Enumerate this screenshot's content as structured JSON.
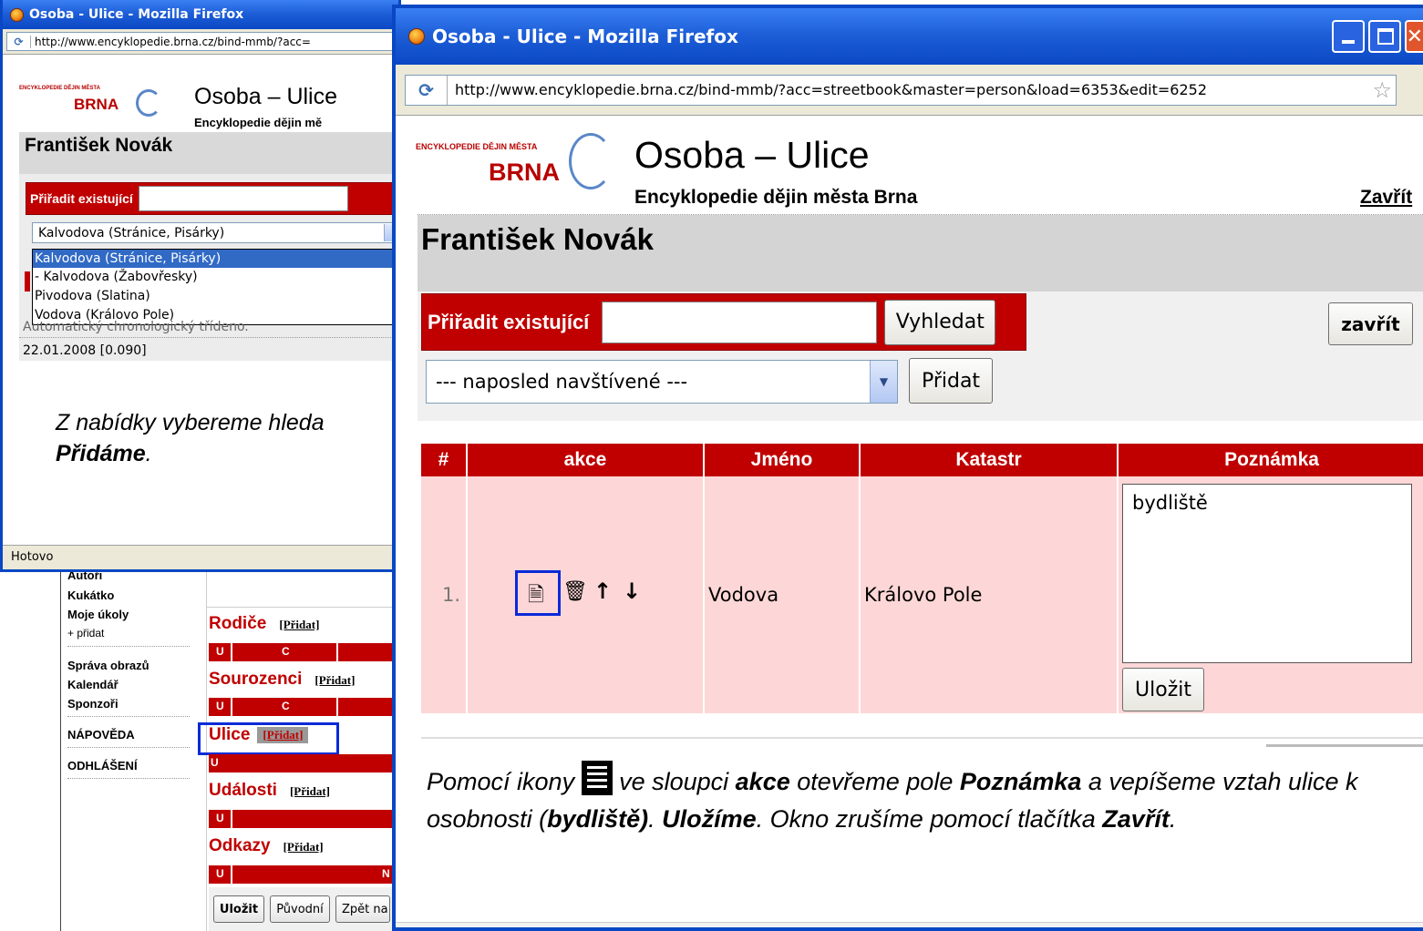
{
  "back_window": {
    "title": "Osoba - Ulice - Mozilla Firefox",
    "url": "http://www.encyklopedie.brna.cz/bind-mmb/?acc=",
    "logo_top": "ENCYKLOPEDIE DĚJIN MĚSTA",
    "logo_brna": "BRNA",
    "site_title": "Osoba – Ulice",
    "site_subtitle": "Encyklopedie dějin mě",
    "person_name": "František Novák",
    "assign_label": "Přiřadit existující",
    "select_value": "Kalvodova (Stránice, Pisárky)",
    "dropdown_options": [
      "Kalvodova (Stránice, Pisárky)",
      "- Kalvodova (Žabovřesky)",
      "Pivodova (Slatina)",
      "Vodova (Královo Pole)"
    ],
    "auto_text": "Automatický chronologický třídeno.",
    "date_text": "22.01.2008 [0.090]",
    "note_line1": "Z nabídky vybereme hleda",
    "note_line2": "Přidáme",
    "note_line2_end": ".",
    "status": "Hotovo"
  },
  "bg_page": {
    "sidebar": [
      "Autoři",
      "Kukátko",
      "Moje úkoly",
      "+ přidat",
      "Správa obrazů",
      "Kalendář",
      "Sponzoři",
      "NÁPOVĚDA",
      "ODHLÁŠENÍ"
    ],
    "sections": [
      {
        "title": "Rodiče",
        "link": "[Přidat]",
        "bar": [
          "U",
          "C"
        ]
      },
      {
        "title": "Sourozenci",
        "link": "[Přidat]",
        "bar": [
          "U",
          "C"
        ]
      },
      {
        "title": "Ulice",
        "link": "[Přidat]",
        "bar": [
          "U"
        ]
      },
      {
        "title": "Události",
        "link": "[Přidat]",
        "bar": [
          "U"
        ]
      },
      {
        "title": "Odkazy",
        "link": "[Přidat]",
        "bar": [
          "U",
          "N"
        ]
      }
    ],
    "buttons": [
      "Uložit",
      "Původní",
      "Zpět na"
    ]
  },
  "front_window": {
    "title": "Osoba - Ulice - Mozilla Firefox",
    "url": "http://www.encyklopedie.brna.cz/bind-mmb/?acc=streetbook&master=person&load=6353&edit=6252",
    "logo_top": "ENCYKLOPEDIE DĚJIN MĚSTA",
    "logo_brna": "BRNA",
    "site_title": "Osoba – Ulice",
    "site_subtitle": "Encyklopedie dějin města Brna",
    "close_link": "Zavřít",
    "person_name": "František Novák",
    "assign_label": "Přiřadit existující",
    "assign_input_value": "",
    "search_button": "Vyhledat",
    "close_button": "zavřít",
    "select_value": "--- naposled navštívené ---",
    "add_button": "Přidat",
    "table": {
      "headers": [
        "#",
        "akce",
        "Jméno",
        "Katastr",
        "Poznámka"
      ],
      "rows": [
        {
          "num": "1.",
          "name": "Vodova",
          "katastr": "Královo Pole",
          "note": "bydliště",
          "save": "Uložit"
        }
      ]
    },
    "instruction": {
      "p1": "Pomocí ikony ",
      "p2": " ve sloupci ",
      "b1": "akce",
      "p3": " otevřeme pole ",
      "b2": "Poznámka",
      "p4": " a vepíšeme vztah ulice k osobnosti  (",
      "b3": "bydliště)",
      "p5": ".  ",
      "b4": "Uložíme",
      "p6": ". Okno zrušíme pomocí tlačítka ",
      "b5": "Zavřít",
      "p7": "."
    }
  },
  "colors": {
    "accent_red": "#c00000",
    "row_pink": "#fdd7d7",
    "xp_blue": "#0a47c4",
    "highlight_blue": "#0a2ad8"
  }
}
